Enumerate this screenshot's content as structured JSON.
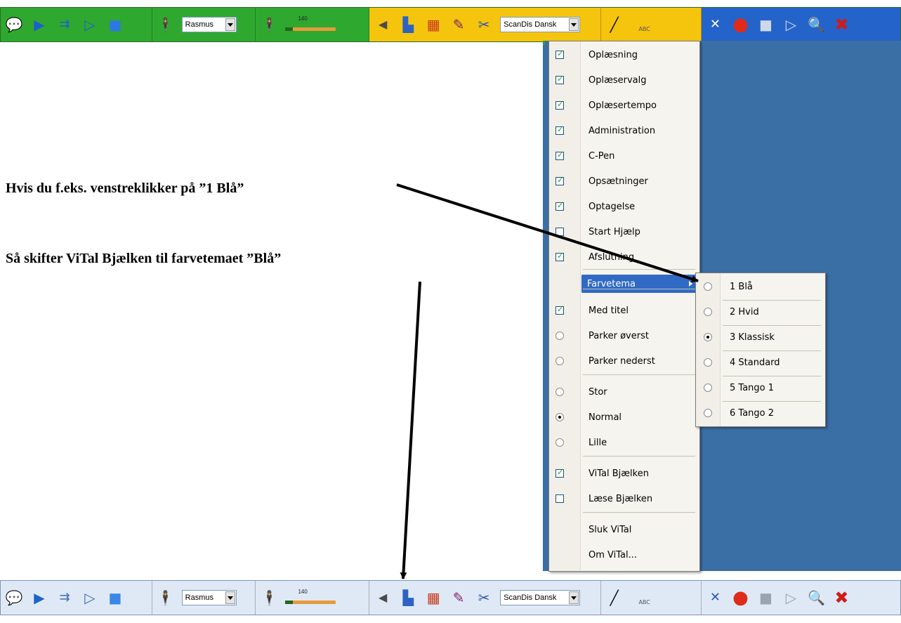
{
  "annotations": {
    "line1": "Hvis du f.eks. venstreklikker på ”1 Blå”",
    "line2": "Så skifter ViTal Bjælken til farvetemaet ”Blå”"
  },
  "toolbar": {
    "voice_select": "Rasmus",
    "speed_value": "140",
    "speed_level_percent": 14,
    "language_select": "ScanDis Dansk",
    "abc_label": "ABC"
  },
  "themes": {
    "klassisk": {
      "left": "#2fa82f",
      "middle": "#f5c40d",
      "right": "#2463c9"
    },
    "blaa": {
      "bg": "#dfe9f6",
      "border": "#7b97b8"
    }
  },
  "menu": {
    "items": [
      {
        "label": "Oplæsning",
        "type": "check",
        "checked": true
      },
      {
        "label": "Oplæservalg",
        "type": "check",
        "checked": true
      },
      {
        "label": "Oplæsertempo",
        "type": "check",
        "checked": true
      },
      {
        "label": "Administration",
        "type": "check",
        "checked": true
      },
      {
        "label": "C-Pen",
        "type": "check",
        "checked": true
      },
      {
        "label": "Opsætninger",
        "type": "check",
        "checked": true
      },
      {
        "label": "Optagelse",
        "type": "check",
        "checked": true
      },
      {
        "label": "Start Hjælp",
        "type": "check",
        "checked": false
      },
      {
        "label": "Afslutning",
        "type": "check",
        "checked": true
      },
      {
        "label": "Farvetema",
        "type": "submenu"
      },
      {
        "label": "Med titel",
        "type": "check",
        "checked": true
      },
      {
        "label": "Parker øverst",
        "type": "radio",
        "checked": false
      },
      {
        "label": "Parker nederst",
        "type": "radio",
        "checked": false
      },
      {
        "label": "Stor",
        "type": "radio",
        "checked": false
      },
      {
        "label": "Normal",
        "type": "radio",
        "checked": true
      },
      {
        "label": "Lille",
        "type": "radio",
        "checked": false
      },
      {
        "label": "ViTal Bjælken",
        "type": "check",
        "checked": true
      },
      {
        "label": "Læse Bjælken",
        "type": "check",
        "checked": false
      },
      {
        "label": "Sluk ViTal",
        "type": "plain"
      },
      {
        "label": "Om ViTal...",
        "type": "plain"
      }
    ],
    "submenu": [
      {
        "label": "1 Blå",
        "checked": false
      },
      {
        "label": "2 Hvid",
        "checked": false
      },
      {
        "label": "3 Klassisk",
        "checked": true
      },
      {
        "label": "4 Standard",
        "checked": false
      },
      {
        "label": "5 Tango 1",
        "checked": false
      },
      {
        "label": "6 Tango 2",
        "checked": false
      }
    ]
  },
  "icons": {
    "speech": "speech-bubble-icon",
    "play": "play-icon",
    "play_line": "play-line-icon",
    "play_word": "play-word-icon",
    "stop": "stop-icon",
    "speaker_person": "speaker-person-icon",
    "volume": "volume-icon",
    "ruler": "ruler-icon",
    "scan_book": "scan-book-icon",
    "cpen": "cpen-icon",
    "settings_tools": "settings-tools-icon",
    "text_format": "text-format-icon",
    "abc": "abc-icon",
    "tools_x": "tools-icon",
    "record": "record-icon",
    "record_stop": "record-stop-icon",
    "record_play": "record-play-icon",
    "help": "help-icon",
    "close": "close-icon"
  }
}
